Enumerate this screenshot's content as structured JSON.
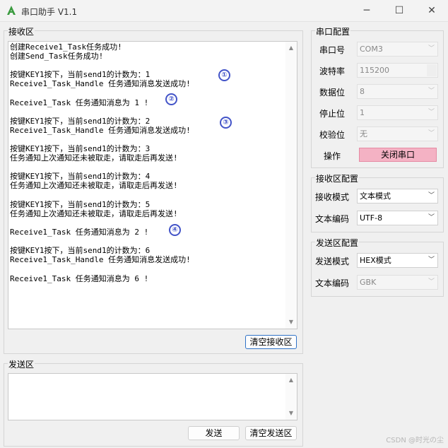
{
  "window": {
    "title": "串口助手 V1.1",
    "minimize_glyph": "─",
    "maximize_glyph": "☐",
    "close_glyph": "✕",
    "accent": "#3a9b3f"
  },
  "receive": {
    "group_title": "接收区",
    "lines": [
      "创建Receive1_Task任务成功!",
      "创建Send_Task任务成功!",
      "",
      "按键KEY1按下，当前send1的计数为：1",
      "Receive1_Task_Handle 任务通知消息发送成功!",
      "",
      "Receive1_Task 任务通知消息为 1 !",
      "",
      "按键KEY1按下，当前send1的计数为：2",
      "Receive1_Task_Handle 任务通知消息发送成功!",
      "",
      "按键KEY1按下，当前send1的计数为：3",
      "任务通知上次通知还未被取走，请取走后再发送!",
      "",
      "按键KEY1按下，当前send1的计数为：4",
      "任务通知上次通知还未被取走，请取走后再发送!",
      "",
      "按键KEY1按下，当前send1的计数为：5",
      "任务通知上次通知还未被取走，请取走后再发送!",
      "",
      "Receive1_Task 任务通知消息为 2 !",
      "",
      "按键KEY1按下，当前send1的计数为：6",
      "Receive1_Task_Handle 任务通知消息发送成功!",
      "",
      "Receive1_Task 任务通知消息为 6 !"
    ],
    "markers": [
      "①",
      "②",
      "③",
      "④"
    ],
    "clear_button": "清空接收区"
  },
  "send": {
    "group_title": "发送区",
    "send_button": "发送",
    "clear_button": "清空发送区"
  },
  "serial_config": {
    "group_title": "串口配置",
    "fields": [
      {
        "label": "串口号",
        "value": "COM3"
      },
      {
        "label": "波特率",
        "value": "115200"
      },
      {
        "label": "数据位",
        "value": "8"
      },
      {
        "label": "停止位",
        "value": "1"
      },
      {
        "label": "校验位",
        "value": "无"
      }
    ],
    "operation_label": "操作",
    "operation_button": "关闭串口",
    "operation_button_color": "#f4b2c4"
  },
  "receive_config": {
    "group_title": "接收区配置",
    "fields": [
      {
        "label": "接收模式",
        "value": "文本模式"
      },
      {
        "label": "文本编码",
        "value": "UTF-8"
      }
    ]
  },
  "send_config": {
    "group_title": "发送区配置",
    "fields": [
      {
        "label": "发送模式",
        "value": "HEX模式"
      },
      {
        "label": "文本编码",
        "value": "GBK"
      }
    ]
  },
  "watermark": "CSDN @时光の尘"
}
